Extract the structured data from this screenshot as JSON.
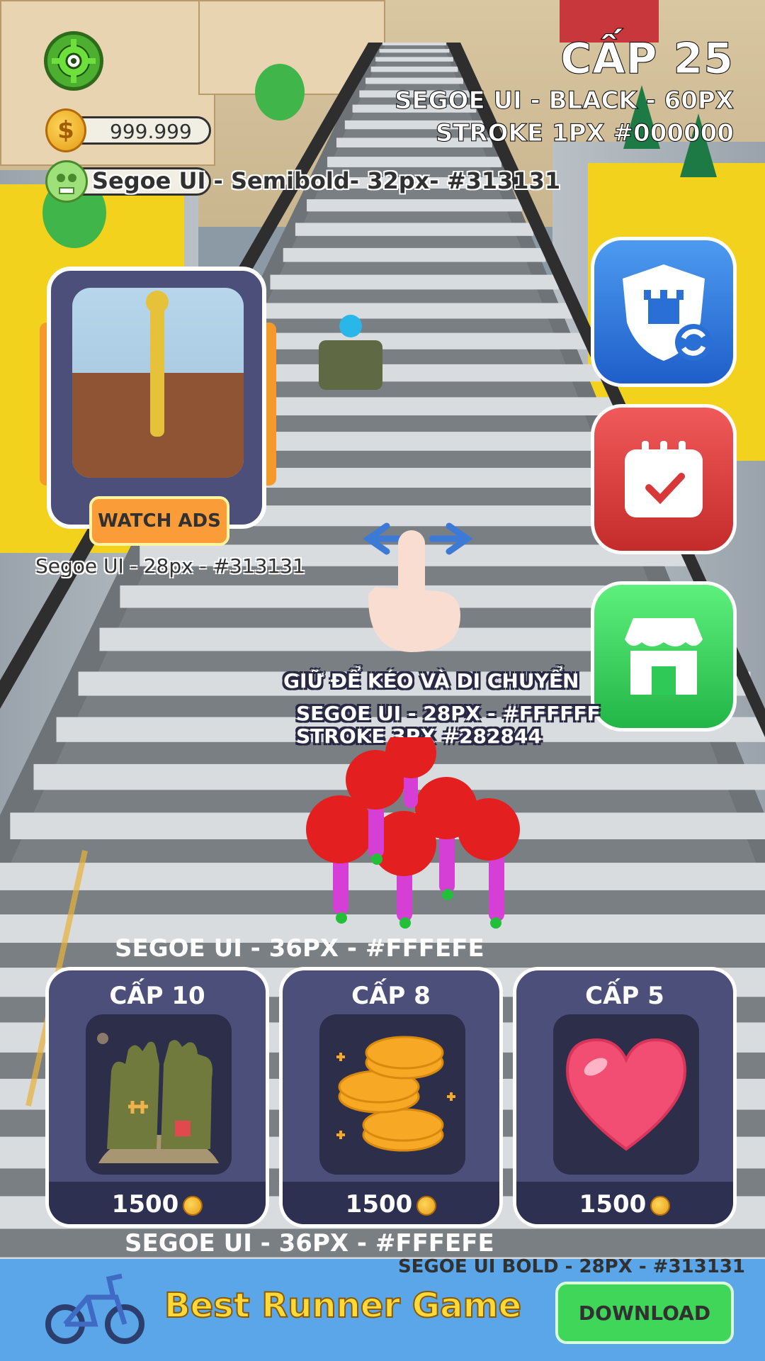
{
  "hud": {
    "settings_icon": "gear-icon",
    "coin_amount": "999.999",
    "coin_symbol": "$",
    "zombie_label": "Segoe UI - Semibold- 32px- #313131",
    "level_title": "CẤP 25",
    "level_note_1": "SEGOE UI - BLACK - 60PX",
    "level_note_2": "STROKE 1PX #000000"
  },
  "ad": {
    "button_label": "WATCH ADS",
    "note": "Segoe UI - 28px - #313131"
  },
  "side_buttons": [
    {
      "icon": "shield-refresh-icon",
      "color": "#2a6fd6"
    },
    {
      "icon": "calendar-check-icon",
      "color": "#d93838"
    },
    {
      "icon": "shop-icon",
      "color": "#2ec956"
    }
  ],
  "tutorial": {
    "instruction": "GIỮ ĐỂ KÉO VÀ DI CHUYỂN",
    "note_1": "SEGOE UI - 28PX - #FFFFFF",
    "note_2": "STROKE 3PX #282844"
  },
  "upgrades": {
    "note_top": "SEGOE UI - 36PX - #FFFEFE",
    "note_bottom": "SEGOE UI - 36PX - #FFFEFE",
    "cards": [
      {
        "level": "CẤP 10",
        "price": "1500",
        "icon": "zombie-hands-icon"
      },
      {
        "level": "CẤP 8",
        "price": "1500",
        "icon": "coin-stack-icon"
      },
      {
        "level": "CẤP 5",
        "price": "1500",
        "icon": "heart-icon"
      }
    ]
  },
  "banner": {
    "note": "SEGOE UI BOLD - 28PX - #313131",
    "title": "Best Runner Game",
    "download_label": "DOWNLOAD",
    "icon": "bicycle-icon"
  },
  "colors": {
    "panel": "#4b4f7a",
    "panel_dark": "#2c2e4a",
    "accent_orange": "#fa9d39",
    "banner_bg": "#5aa6e8"
  }
}
